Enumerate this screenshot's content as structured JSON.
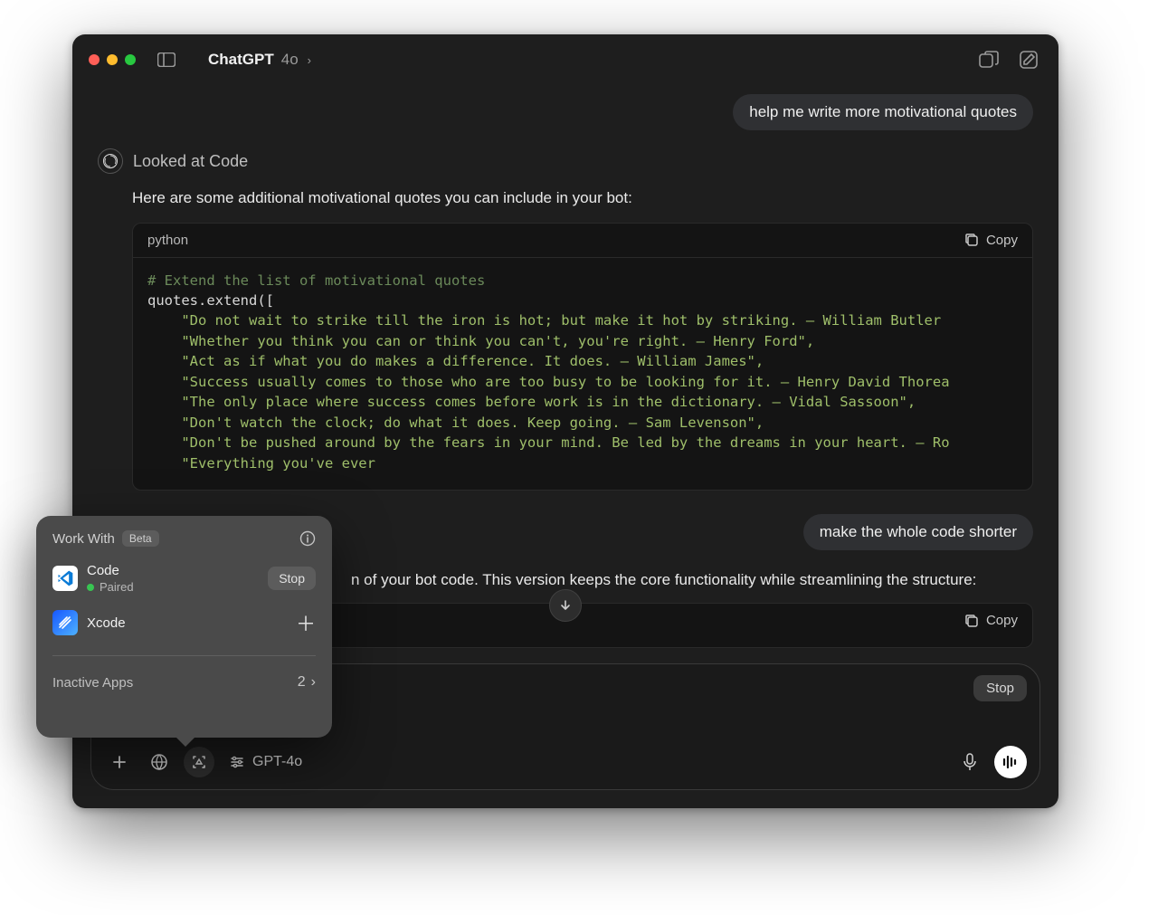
{
  "titlebar": {
    "app_name": "ChatGPT",
    "model": "4o"
  },
  "messages": {
    "user1": "help me write more motivational quotes",
    "looked_at": "Looked at Code",
    "assist1": "Here are some additional motivational quotes you can include in your bot:",
    "user2": "make the whole code shorter",
    "assist2_partial": "n of your bot code. This version keeps the core functionality while streamlining the structure:"
  },
  "code": {
    "lang": "python",
    "copy": "Copy",
    "comment": "# Extend the list of motivational quotes",
    "line0": "quotes.extend([",
    "lines": [
      "\"Do not wait to strike till the iron is hot; but make it hot by striking. – William Butler",
      "\"Whether you think you can or think you can't, you're right. – Henry Ford\",",
      "\"Act as if what you do makes a difference. It does. – William James\",",
      "\"Success usually comes to those who are too busy to be looking for it. – Henry David Thorea",
      "\"The only place where success comes before work is in the dictionary. – Vidal Sassoon\",",
      "\"Don't watch the clock; do what it does. Keep going. – Sam Levenson\",",
      "\"Don't be pushed around by the fears in your mind. Be led by the dreams in your heart. – Ro",
      "\"Everything you've ever"
    ]
  },
  "composer": {
    "stop": "Stop",
    "model_label": "GPT-4o"
  },
  "popup": {
    "title": "Work With",
    "beta": "Beta",
    "apps": [
      {
        "name": "Code",
        "paired": "Paired",
        "action": "Stop"
      },
      {
        "name": "Xcode"
      }
    ],
    "inactive_label": "Inactive Apps",
    "inactive_count": "2"
  }
}
